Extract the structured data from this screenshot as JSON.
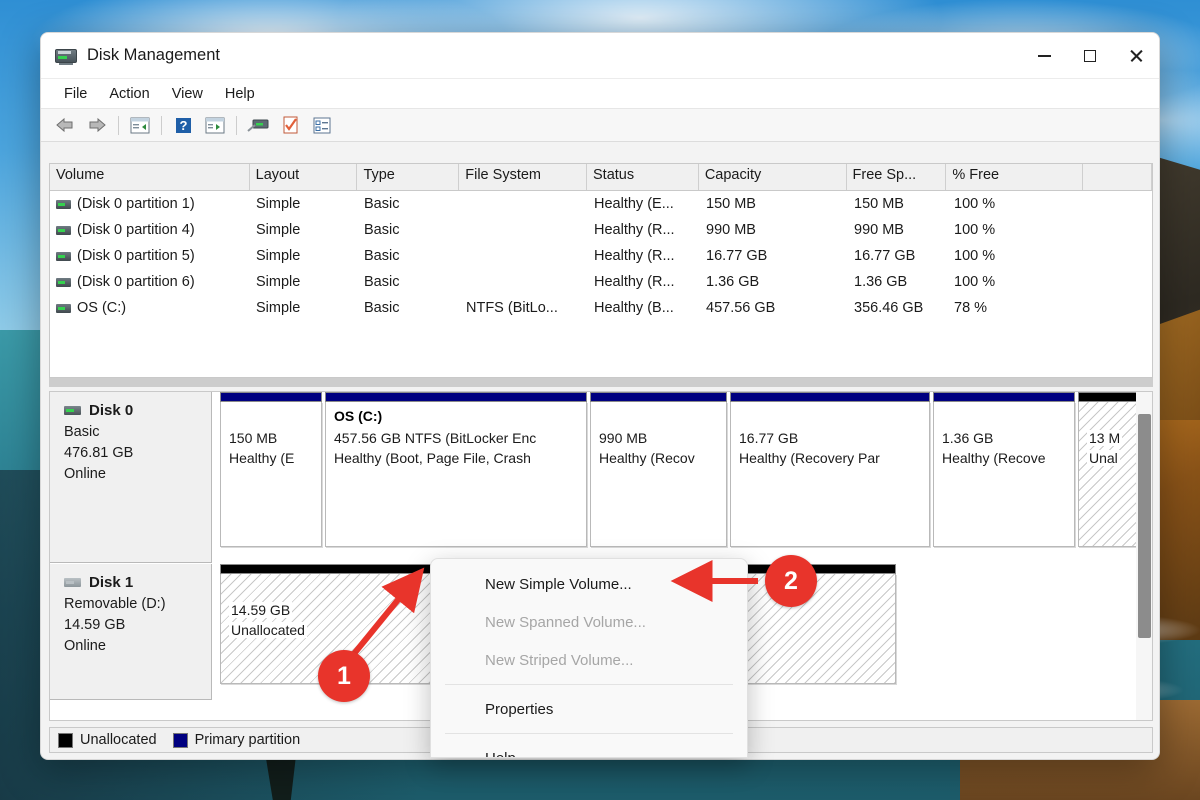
{
  "window": {
    "title": "Disk Management",
    "icon": "disk-drive-icon",
    "controls": {
      "minimize": "—",
      "maximize": "□",
      "close": "✕"
    }
  },
  "menubar": {
    "items": [
      "File",
      "Action",
      "View",
      "Help"
    ]
  },
  "toolbar": {
    "buttons": [
      "back-arrow",
      "forward-arrow",
      "show-hide-console-tree",
      "help",
      "show-hide-action-pane",
      "rescan-disks",
      "properties",
      "action-list"
    ]
  },
  "volume_list": {
    "columns": [
      "Volume",
      "Layout",
      "Type",
      "File System",
      "Status",
      "Capacity",
      "Free Sp...",
      "% Free"
    ],
    "rows": [
      {
        "volume": "(Disk 0 partition 1)",
        "layout": "Simple",
        "type": "Basic",
        "filesystem": "",
        "status": "Healthy (E...",
        "capacity": "150 MB",
        "free": "150 MB",
        "pctfree": "100 %"
      },
      {
        "volume": "(Disk 0 partition 4)",
        "layout": "Simple",
        "type": "Basic",
        "filesystem": "",
        "status": "Healthy (R...",
        "capacity": "990 MB",
        "free": "990 MB",
        "pctfree": "100 %"
      },
      {
        "volume": "(Disk 0 partition 5)",
        "layout": "Simple",
        "type": "Basic",
        "filesystem": "",
        "status": "Healthy (R...",
        "capacity": "16.77 GB",
        "free": "16.77 GB",
        "pctfree": "100 %"
      },
      {
        "volume": "(Disk 0 partition 6)",
        "layout": "Simple",
        "type": "Basic",
        "filesystem": "",
        "status": "Healthy (R...",
        "capacity": "1.36 GB",
        "free": "1.36 GB",
        "pctfree": "100 %"
      },
      {
        "volume": "OS (C:)",
        "layout": "Simple",
        "type": "Basic",
        "filesystem": "NTFS (BitLo...",
        "status": "Healthy (B...",
        "capacity": "457.56 GB",
        "free": "356.46 GB",
        "pctfree": "78 %"
      }
    ]
  },
  "disks": [
    {
      "name": "Disk 0",
      "type": "Basic",
      "size": "476.81 GB",
      "state": "Online",
      "partitions": [
        {
          "label": "",
          "size": "150 MB",
          "status": "Healthy (E",
          "kind": "primary"
        },
        {
          "label": "OS  (C:)",
          "size": "457.56 GB NTFS (BitLocker Enc",
          "status": "Healthy (Boot, Page File, Crash",
          "kind": "primary"
        },
        {
          "label": "",
          "size": "990 MB",
          "status": "Healthy (Recov",
          "kind": "primary"
        },
        {
          "label": "",
          "size": "16.77 GB",
          "status": "Healthy (Recovery Par",
          "kind": "primary"
        },
        {
          "label": "",
          "size": "1.36 GB",
          "status": "Healthy (Recove",
          "kind": "primary"
        },
        {
          "label": "",
          "size": "13 M",
          "status": "Unal",
          "kind": "unallocated"
        }
      ]
    },
    {
      "name": "Disk 1",
      "type": "Removable (D:)",
      "size": "14.59 GB",
      "state": "Online",
      "partitions": [
        {
          "label": "",
          "size": "14.59 GB",
          "status": "Unallocated",
          "kind": "unallocated"
        }
      ]
    }
  ],
  "legend": [
    {
      "label": "Unallocated",
      "color": "#000000"
    },
    {
      "label": "Primary partition",
      "color": "#000080"
    }
  ],
  "context_menu": {
    "items": [
      {
        "label": "New Simple Volume...",
        "disabled": false
      },
      {
        "label": "New Spanned Volume...",
        "disabled": true
      },
      {
        "label": "New Striped Volume...",
        "disabled": true
      },
      {
        "separator": true
      },
      {
        "label": "Properties",
        "disabled": false
      },
      {
        "separator": true
      },
      {
        "label": "Help",
        "disabled": false
      }
    ]
  },
  "annotations": [
    {
      "number": "1",
      "target": "unallocated-space-disk1"
    },
    {
      "number": "2",
      "target": "new-simple-volume-menu-item"
    }
  ],
  "colors": {
    "primary_partition": "#000080",
    "unallocated": "#000000",
    "annotation": "#e8342b"
  }
}
